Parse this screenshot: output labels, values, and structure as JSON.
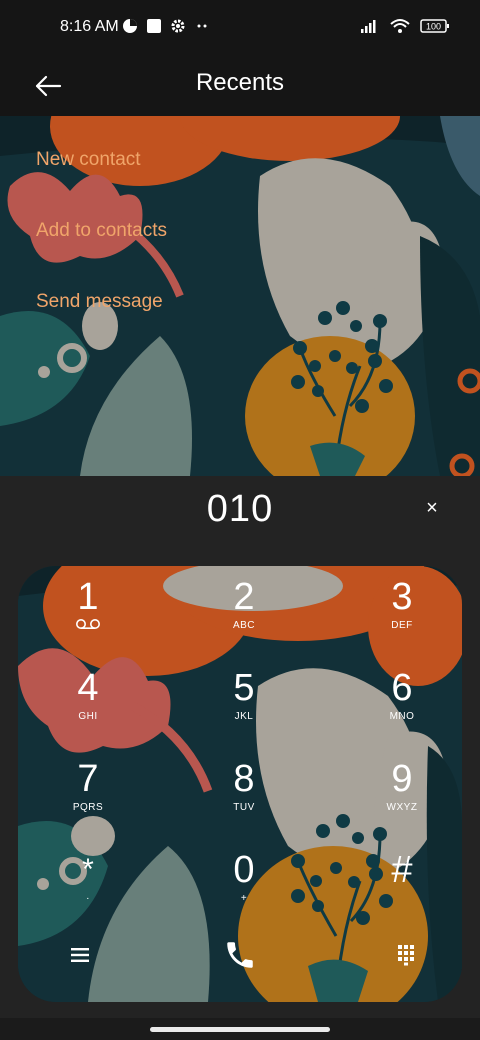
{
  "status": {
    "time": "8:16 AM",
    "battery": "100"
  },
  "appbar": {
    "title": "Recents"
  },
  "menu": [
    {
      "label": "New contact"
    },
    {
      "label": "Add to contacts"
    },
    {
      "label": "Send message"
    }
  ],
  "dialer": {
    "number": "010",
    "clear_label": "×"
  },
  "keys": [
    {
      "digit": "1",
      "letters": ""
    },
    {
      "digit": "2",
      "letters": "ABC"
    },
    {
      "digit": "3",
      "letters": "DEF"
    },
    {
      "digit": "4",
      "letters": "GHI"
    },
    {
      "digit": "5",
      "letters": "JKL"
    },
    {
      "digit": "6",
      "letters": "MNO"
    },
    {
      "digit": "7",
      "letters": "PQRS"
    },
    {
      "digit": "8",
      "letters": "TUV"
    },
    {
      "digit": "9",
      "letters": "WXYZ"
    },
    {
      "digit": "*",
      "letters": "·"
    },
    {
      "digit": "0",
      "letters": "+"
    },
    {
      "digit": "#",
      "letters": ""
    }
  ],
  "colors": {
    "accent": "#f0a56a",
    "panel": "#232323",
    "statusbar": "#151515"
  }
}
